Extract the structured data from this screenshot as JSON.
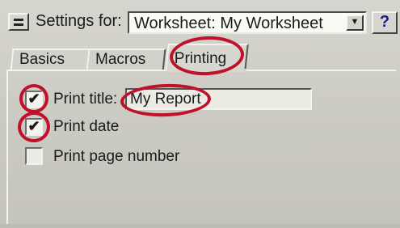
{
  "header": {
    "settings_label": "Settings for:",
    "selected_settings": "Worksheet: My Worksheet",
    "help_label": "?"
  },
  "tabs": [
    {
      "label": "Basics"
    },
    {
      "label": "Macros"
    },
    {
      "label": "Printing",
      "selected": true
    }
  ],
  "printing": {
    "print_title_label": "Print title:",
    "print_title_value": "My Report",
    "print_title_checked": true,
    "print_date_label": "Print date",
    "print_date_checked": true,
    "print_page_number_label": "Print page number",
    "print_page_number_checked": false
  },
  "icons": {
    "settings_button": "list-icon",
    "dropdown": "dropdown-arrow-icon",
    "help": "help-question-icon"
  },
  "colors": {
    "highlight": "#c0102a",
    "dialog_bg": "#cdccc4"
  }
}
